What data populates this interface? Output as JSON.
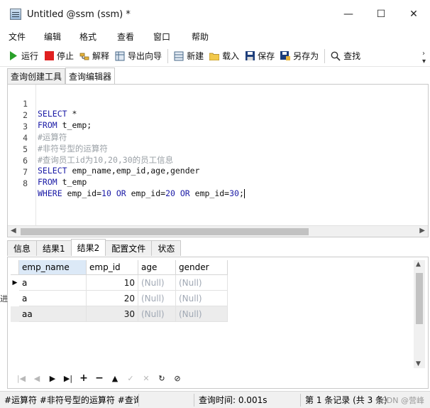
{
  "window": {
    "title": "Untitled @ssm (ssm) *",
    "minimize": "—",
    "maximize": "☐",
    "close": "✕"
  },
  "menu": [
    "文件",
    "编辑",
    "格式",
    "查看",
    "窗口",
    "帮助"
  ],
  "toolbar": {
    "run": "运行",
    "stop": "停止",
    "explain": "解释",
    "export": "导出向导",
    "new": "新建",
    "load": "载入",
    "save": "保存",
    "save_as": "另存为",
    "find": "查找"
  },
  "query_tabs": [
    "查询创建工具",
    "查询编辑器"
  ],
  "editor": {
    "line_numbers": [
      "1",
      "2",
      "3",
      "4",
      "5",
      "6",
      "7",
      "8"
    ]
  },
  "result_tabs": [
    "信息",
    "结果1",
    "结果2",
    "配置文件",
    "状态"
  ],
  "grid": {
    "columns": [
      "emp_name",
      "emp_id",
      "age",
      "gender"
    ],
    "rows": [
      {
        "emp_name": "a",
        "emp_id": "10",
        "age": "(Null)",
        "gender": "(Null)"
      },
      {
        "emp_name": "a",
        "emp_id": "20",
        "age": "(Null)",
        "gender": "(Null)"
      },
      {
        "emp_name": "aa",
        "emp_id": "30",
        "age": "(Null)",
        "gender": "(Null)"
      }
    ]
  },
  "status": {
    "query_text": "#运算符 #非符号型的运算符 #查询",
    "query_time": "查询时间: 0.001s",
    "records": "第 1 条记录 (共 3 条)",
    "watermark": "CSDN @营峰"
  },
  "left_strip": "进"
}
